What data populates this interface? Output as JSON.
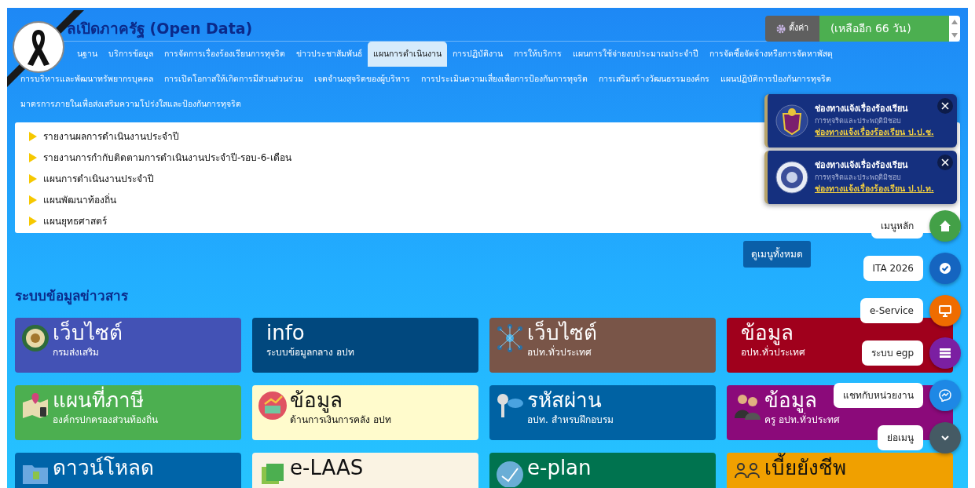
{
  "header": {
    "title": "ลเปิดภาครัฐ (Open Data)",
    "settings_button": "ตั้งค่า",
    "countdown": "(เหลืออีก 66 วัน)"
  },
  "menu_rows": [
    {
      "items": [
        {
          "label": "นฐาน",
          "selected": false
        },
        {
          "label": "บริการข้อมูล",
          "selected": false
        },
        {
          "label": "การจัดการเรื่องร้องเรียนการทุจริต",
          "selected": false
        },
        {
          "label": "ข่าวประชาสัมพันธ์",
          "selected": false
        },
        {
          "label": "แผนการดำเนินงาน",
          "selected": true
        },
        {
          "label": "การปฏิบัติงาน",
          "selected": false
        },
        {
          "label": "การให้บริการ",
          "selected": false
        },
        {
          "label": "แผนการใช้จ่ายงบประมาณประจำปี",
          "selected": false
        },
        {
          "label": "การจัดซื้อจัดจ้างหรือการจัดหาพัสดุ",
          "selected": false
        }
      ]
    },
    {
      "items": [
        {
          "label": "การบริหารและพัฒนาทรัพยากรบุคคล",
          "selected": false
        },
        {
          "label": "การเปิดโอกาสให้เกิดการมีส่วนส่วนร่วม",
          "selected": false
        },
        {
          "label": "เจตจำนงสุจริตของผู้บริหาร",
          "selected": false
        },
        {
          "label": "การประเมินความเสี่ยงเพื่อการป้องกันการทุจริต",
          "selected": false
        },
        {
          "label": "การเสริมสร้างวัฒนธรรมองค์กร",
          "selected": false
        },
        {
          "label": "แผนปฏิบัติการป้องกันการทุจริต",
          "selected": false
        }
      ]
    },
    {
      "items": [
        {
          "label": "มาตรการภายในเพื่อส่งเสริมความโปร่งใสและป้องกันการทุจริต",
          "selected": false
        }
      ]
    }
  ],
  "list_items": [
    "รายงานผลการดำเนินงานประจำปี",
    "รายงานการกำกับติดตามการดำเนินงานประจำปี-รอบ-6-เดือน",
    "แผนการดำเนินงานประจำปี",
    "แผนพัฒนาท้องถิ่น",
    "แผนยุทธศาสตร์"
  ],
  "all_menu_button": "ดูเมนูทั้งหมด",
  "section_title": "ระบบข้อมูลข่าวสาร",
  "tiles": [
    {
      "title": "เว็บไซต์",
      "subtitle": "กรมส่งเสริม",
      "color": "#4352b5"
    },
    {
      "title": "info",
      "subtitle": "ระบบข้อมูลกลาง อปท",
      "color": "#01487e"
    },
    {
      "title": "เว็บไซต์",
      "subtitle": "อปท.ทั่วประเทศ",
      "color": "#795548"
    },
    {
      "title": "ข้อมูล",
      "subtitle": "อปท.ทั่วประเทศ",
      "color": "#a0001c"
    },
    {
      "title": "แผนที่ภาษี",
      "subtitle": "องค์กรปกครองส่วนท้องถิ่น",
      "color": "#4caf50"
    },
    {
      "title": "ข้อมูล",
      "subtitle": "ด้านการเงินการคลัง อปท",
      "color": "#fffbcc"
    },
    {
      "title": "รหัสผ่าน",
      "subtitle": "อปท. สำหรบฝึกอบรม",
      "color": "#0062a3"
    },
    {
      "title": "ข้อมูล",
      "subtitle": "ครู อปท.ทั่วประทศ",
      "color": "#8b0a7a"
    },
    {
      "title": "ดาวน์โหลด",
      "color": "#0064a8"
    },
    {
      "title": "e-LAAS",
      "color": "#faf3e3"
    },
    {
      "title": "e-plan",
      "color": "#00734f"
    },
    {
      "title": "เบี้ยยังชีพ",
      "color": "#f0a000"
    }
  ],
  "notices": [
    {
      "title": "ช่องทางแจ้งเรื่องร้องเรียน",
      "subtitle": "การทุจริตและประพฤติมิชอบ",
      "link": "ช่องทางแจ้งเรื่องร้องเรียน ป.ป.ช."
    },
    {
      "title": "ช่องทางแจ้งเรื่องร้องเรียน",
      "subtitle": "การทุจริตและประพฤติมิชอบ",
      "link": "ช่องทางแจ้งเรื่องร้องเรียน ป.ป.ท."
    }
  ],
  "quick_menu": [
    {
      "label": "เมนูหลัก",
      "color": "#43a047"
    },
    {
      "label": "ITA 2026",
      "color": "#1565c0"
    },
    {
      "label": "e-Service",
      "color": "#ef6c00"
    },
    {
      "label": "ระบบ egp",
      "color": "#7b1fa2"
    },
    {
      "label": "แชทกับหน่วยงาน",
      "color": "#1e88e5"
    },
    {
      "label": "ย่อเมนู",
      "color": "#455a64"
    }
  ]
}
